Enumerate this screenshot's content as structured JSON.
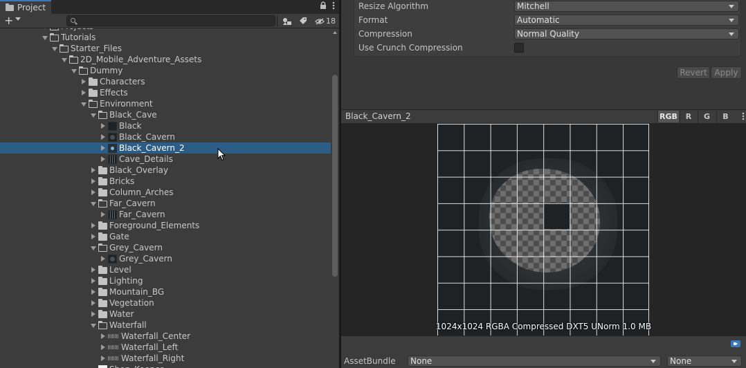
{
  "project_panel": {
    "tab_label": "Project",
    "lock_icon": "lock-icon",
    "menu_icon": "kebab-icon",
    "toolbar": {
      "add_label": "+",
      "search_placeholder": "",
      "hidden_count": "18"
    },
    "tree": [
      {
        "label": "Projects",
        "depth": 4,
        "state": "open",
        "kind": "folder"
      },
      {
        "label": "Tutorials",
        "depth": 4,
        "state": "open",
        "kind": "folder"
      },
      {
        "label": "Starter_Files",
        "depth": 5,
        "state": "open",
        "kind": "folder"
      },
      {
        "label": "2D_Mobile_Adventure_Assets",
        "depth": 6,
        "state": "open",
        "kind": "folder"
      },
      {
        "label": "Dummy",
        "depth": 7,
        "state": "open",
        "kind": "folder"
      },
      {
        "label": "Characters",
        "depth": 8,
        "state": "closed",
        "kind": "folder"
      },
      {
        "label": "Effects",
        "depth": 8,
        "state": "closed",
        "kind": "folder"
      },
      {
        "label": "Environment",
        "depth": 8,
        "state": "open",
        "kind": "folder"
      },
      {
        "label": "Black_Cave",
        "depth": 9,
        "state": "open",
        "kind": "folder"
      },
      {
        "label": "Black",
        "depth": 10,
        "state": "closed",
        "kind": "texture"
      },
      {
        "label": "Black_Cavern",
        "depth": 10,
        "state": "closed",
        "kind": "texture-blob"
      },
      {
        "label": "Black_Cavern_2",
        "depth": 10,
        "state": "closed",
        "kind": "texture-selected",
        "selected": true
      },
      {
        "label": "Cave_Details",
        "depth": 10,
        "state": "closed",
        "kind": "texture-dots"
      },
      {
        "label": "Black_Overlay",
        "depth": 9,
        "state": "closed",
        "kind": "folder"
      },
      {
        "label": "Bricks",
        "depth": 9,
        "state": "closed",
        "kind": "folder"
      },
      {
        "label": "Column_Arches",
        "depth": 9,
        "state": "closed",
        "kind": "folder"
      },
      {
        "label": "Far_Cavern",
        "depth": 9,
        "state": "open",
        "kind": "folder"
      },
      {
        "label": "Far_Cavern",
        "depth": 10,
        "state": "closed",
        "kind": "texture-dots"
      },
      {
        "label": "Foreground_Elements",
        "depth": 9,
        "state": "closed",
        "kind": "folder"
      },
      {
        "label": "Gate",
        "depth": 9,
        "state": "closed",
        "kind": "folder"
      },
      {
        "label": "Grey_Cavern",
        "depth": 9,
        "state": "open",
        "kind": "folder"
      },
      {
        "label": "Grey_Cavern",
        "depth": 10,
        "state": "closed",
        "kind": "texture-blob"
      },
      {
        "label": "Level",
        "depth": 9,
        "state": "closed",
        "kind": "folder"
      },
      {
        "label": "Lighting",
        "depth": 9,
        "state": "closed",
        "kind": "folder"
      },
      {
        "label": "Mountain_BG",
        "depth": 9,
        "state": "closed",
        "kind": "folder"
      },
      {
        "label": "Vegetation",
        "depth": 9,
        "state": "closed",
        "kind": "folder"
      },
      {
        "label": "Water",
        "depth": 9,
        "state": "closed",
        "kind": "folder"
      },
      {
        "label": "Waterfall",
        "depth": 9,
        "state": "open",
        "kind": "folder"
      },
      {
        "label": "Waterfall_Center",
        "depth": 10,
        "state": "closed",
        "kind": "texture-stripe"
      },
      {
        "label": "Waterfall_Left",
        "depth": 10,
        "state": "closed",
        "kind": "texture-stripe"
      },
      {
        "label": "Waterfall_Right",
        "depth": 10,
        "state": "closed",
        "kind": "texture-stripe"
      },
      {
        "label": "Shop_Keeper",
        "depth": 9,
        "state": "none",
        "kind": "texture-white"
      }
    ]
  },
  "import_settings": {
    "resize_algorithm": {
      "label": "Resize Algorithm",
      "value": "Mitchell"
    },
    "format": {
      "label": "Format",
      "value": "Automatic"
    },
    "compression": {
      "label": "Compression",
      "value": "Normal Quality"
    },
    "crunch": {
      "label": "Use Crunch Compression",
      "checked": false
    },
    "revert_label": "Revert",
    "apply_label": "Apply"
  },
  "preview": {
    "title": "Black_Cavern_2",
    "channels": [
      "RGB",
      "R",
      "G",
      "B"
    ],
    "active_channel": "RGB",
    "info": "1024x1024  RGBA Compressed DXT5 UNorm  1.0 MB"
  },
  "asset_bundle": {
    "label": "AssetBundle",
    "name_value": "None",
    "variant_value": "None"
  },
  "colors": {
    "selection": "#2c5d87",
    "accent": "#3a79bb"
  }
}
